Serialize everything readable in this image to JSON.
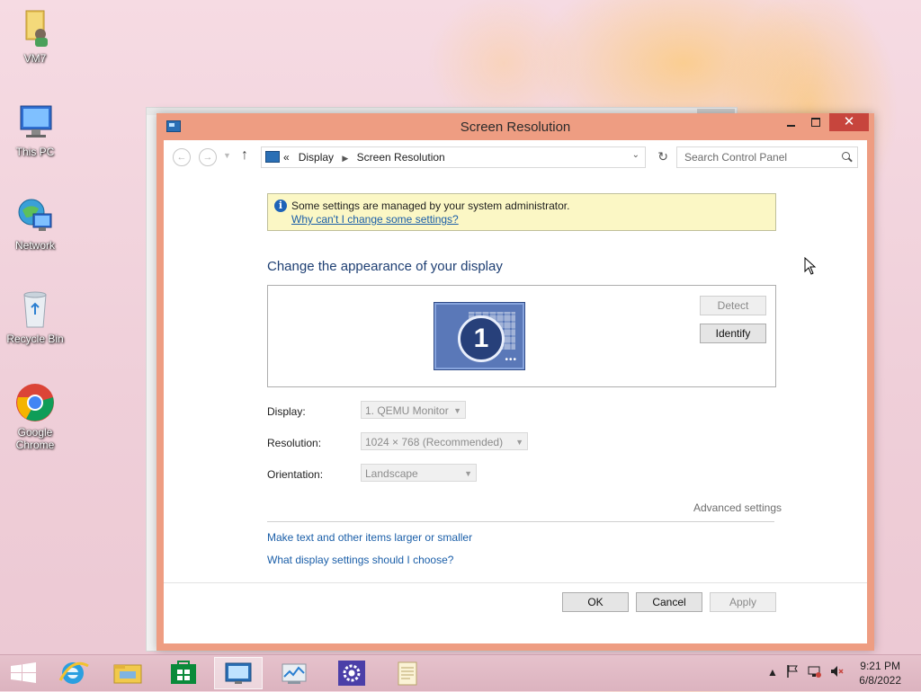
{
  "desktop": {
    "icons": [
      {
        "label": "VM7"
      },
      {
        "label": "This PC"
      },
      {
        "label": "Network"
      },
      {
        "label": "Recycle Bin"
      },
      {
        "label": "Google Chrome"
      }
    ]
  },
  "window": {
    "title": "Screen Resolution",
    "close_glyph": "✕"
  },
  "nav": {
    "breadcrumb_root": "«",
    "breadcrumb": [
      "Display",
      "Screen Resolution"
    ],
    "search_placeholder": "Search Control Panel"
  },
  "info_bar": {
    "message": "Some settings are managed by your system administrator.",
    "link": "Why can't I change some settings?"
  },
  "main": {
    "heading": "Change the appearance of your display",
    "monitor_number": "1",
    "detect_label": "Detect",
    "identify_label": "Identify",
    "display_label": "Display:",
    "display_value": "1. QEMU Monitor",
    "resolution_label": "Resolution:",
    "resolution_value": "1024 × 768 (Recommended)",
    "orientation_label": "Orientation:",
    "orientation_value": "Landscape",
    "advanced_label": "Advanced settings",
    "link_larger": "Make text and other items larger or smaller",
    "link_choose": "What display settings should I choose?"
  },
  "footer": {
    "ok_label": "OK",
    "cancel_label": "Cancel",
    "apply_label": "Apply"
  },
  "taskbar": {
    "items": [
      "start-icon",
      "internet-explorer-icon",
      "file-explorer-icon",
      "store-icon",
      "screen-resolution-icon",
      "performance-icon",
      "settings-icon",
      "notepad-icon"
    ],
    "time": "9:21 PM",
    "date": "6/8/2022"
  },
  "colors": {
    "window_border": "#ee9d82",
    "close_button": "#c7453d",
    "link": "#1a5ea8",
    "heading": "#1e3f73",
    "info_bar": "#fbf7c5"
  }
}
